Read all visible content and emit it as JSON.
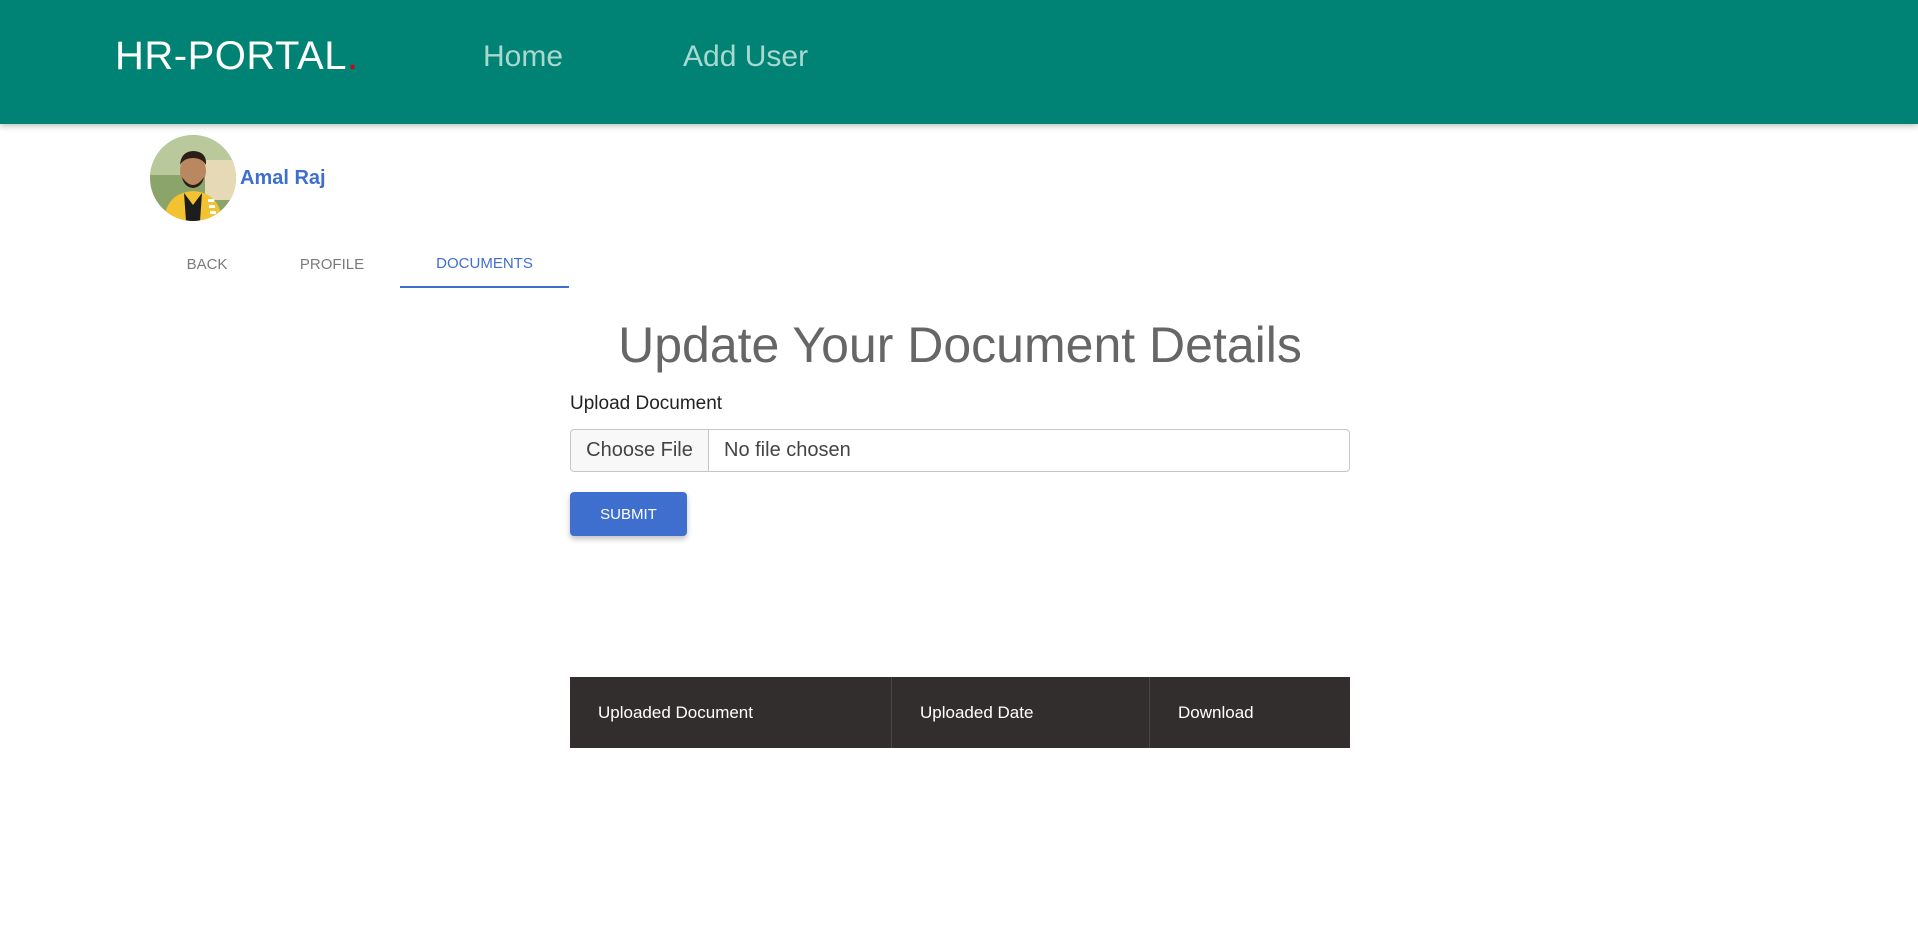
{
  "navbar": {
    "brand": "HR-PORTAL",
    "brand_dot": ".",
    "links": [
      "Home",
      "Add User"
    ],
    "bg_color": "#008374"
  },
  "user": {
    "name": "Amal Raj"
  },
  "tabs": [
    {
      "label": "BACK",
      "active": false
    },
    {
      "label": "PROFILE",
      "active": false
    },
    {
      "label": "DOCUMENTS",
      "active": true
    }
  ],
  "form": {
    "title": "Update Your Document Details",
    "upload_label": "Upload Document",
    "choose_file_label": "Choose File",
    "file_status": "No file chosen",
    "submit_label": "SUBMIT"
  },
  "table": {
    "headers": [
      "Uploaded Document",
      "Uploaded Date",
      "Download"
    ],
    "rows": []
  },
  "colors": {
    "accent": "#3f6fce",
    "table_header": "#322e2d"
  }
}
